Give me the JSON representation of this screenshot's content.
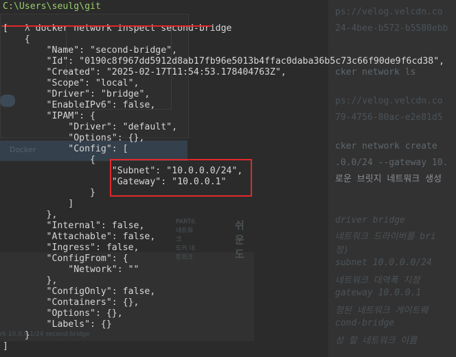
{
  "background": {
    "editor_lines": [
      {
        "text": "ps://velog.velcdn.co",
        "tone": "ghost-faint"
      },
      {
        "text": "24-4bee-b572-b5580ebb",
        "tone": "ghost-faint"
      },
      {
        "text": "cker network ls",
        "tone": "ghost-mid"
      },
      {
        "text": "ps://velog.velcdn.co",
        "tone": "ghost-faint"
      },
      {
        "text": "79-4756-80ac-e2e81d5",
        "tone": "ghost-faint"
      },
      {
        "text": "cker network create ",
        "tone": "ghost-mid"
      },
      {
        "text": ".0.0/24 --gateway 10.",
        "tone": "ghost-mid"
      },
      {
        "text": "로운 브릿지 네트워크 생성",
        "tone": "ghost-bright"
      },
      {
        "text": "driver bridge",
        "tone": "ghost-italic"
      },
      {
        "text": "네트워크 드라이버를 bri",
        "tone": "ghost-italic"
      },
      {
        "text": "정)",
        "tone": "ghost-italic"
      },
      {
        "text": "subnet 10.0.0.0/24",
        "tone": "ghost-italic"
      },
      {
        "text": "네트워크 대역폭 지정",
        "tone": "ghost-italic"
      },
      {
        "text": "gateway 10.0.0.1",
        "tone": "ghost-italic"
      },
      {
        "text": "정된 네트워크 게이트웨",
        "tone": "ghost-italic"
      },
      {
        "text": "cond-bridge",
        "tone": "ghost-italic"
      },
      {
        "text": "성 할 네트워크 이름",
        "tone": "ghost-italic"
      }
    ],
    "slide_bar_label": "Docker",
    "slide_label_1": "PART6. 네트워크",
    "slide_label_2": "도커 네트워크",
    "slide_big_text": "쉬운 도",
    "slide_caption": "rk 10.0.0.1/24 second-bridge"
  },
  "terminal": {
    "path": "C:\\Users\\seulg\\git",
    "prompt_symbol": "λ",
    "command": "docker network inspect second-bridge",
    "output_lines": [
      "[",
      "    {",
      "        \"Name\": \"second-bridge\",",
      "        \"Id\": \"0190c8f967dd5912d8ab17fb96e5013b4ffac0daba36b5c73c66f90de9f6cd38\",",
      "        \"Created\": \"2025-02-17T11:54:53.178404763Z\",",
      "        \"Scope\": \"local\",",
      "        \"Driver\": \"bridge\",",
      "        \"EnableIPv6\": false,",
      "        \"IPAM\": {",
      "            \"Driver\": \"default\",",
      "            \"Options\": {},",
      "            \"Config\": [",
      "                {",
      "                    \"Subnet\": \"10.0.0.0/24\",",
      "                    \"Gateway\": \"10.0.0.1\"",
      "                }",
      "            ]",
      "        },",
      "        \"Internal\": false,",
      "        \"Attachable\": false,",
      "        \"Ingress\": false,",
      "        \"ConfigFrom\": {",
      "            \"Network\": \"\"",
      "        },",
      "        \"ConfigOnly\": false,",
      "        \"Containers\": {},",
      "        \"Options\": {},",
      "        \"Labels\": {}",
      "    }",
      "]"
    ]
  },
  "colors": {
    "background": "#2b2b2b",
    "path_green": "#9acc6b",
    "annotation_red": "#e3282b",
    "text": "#d8d8d8"
  }
}
